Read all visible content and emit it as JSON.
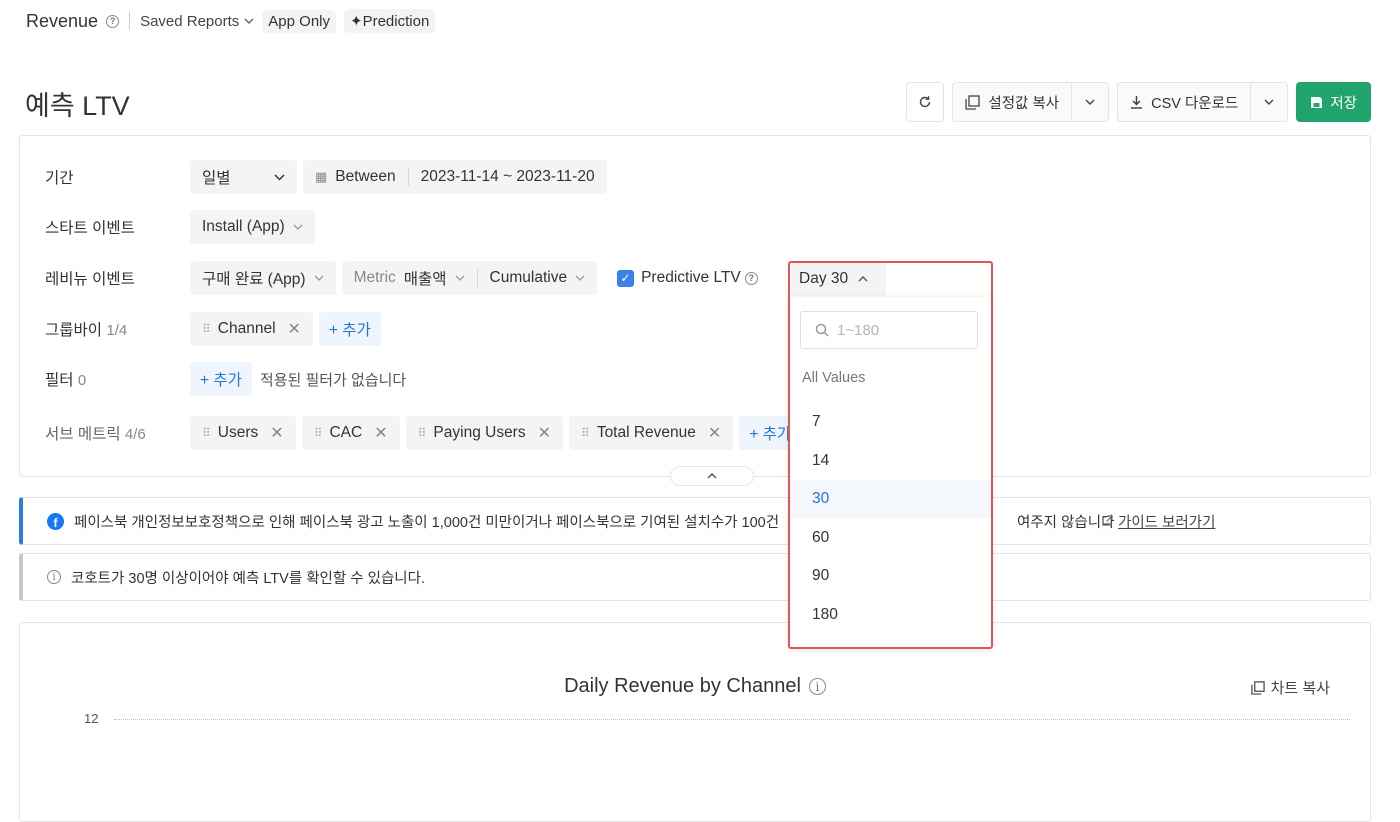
{
  "topbar": {
    "title": "Revenue",
    "saved_reports": "Saved Reports",
    "app_only": "App Only",
    "prediction": "Prediction"
  },
  "page": {
    "title": "예측 LTV"
  },
  "toolbar": {
    "copy_settings": "설정값 복사",
    "csv_download": "CSV 다운로드",
    "save": "저장"
  },
  "settings": {
    "period": {
      "label": "기간",
      "granularity": "일별",
      "operator": "Between",
      "date_range": "2023-11-14 ~ 2023-11-20"
    },
    "start_event": {
      "label": "스타트 이벤트",
      "value": "Install (App)"
    },
    "revenue_event": {
      "label": "레비뉴 이벤트",
      "event": "구매 완료 (App)",
      "metric_label": "Metric",
      "metric_value": "매출액",
      "mode": "Cumulative",
      "predictive_label": "Predictive LTV",
      "predictive_checked": true
    },
    "groupby": {
      "label": "그룹바이",
      "count": "1/4",
      "items": [
        "Channel"
      ],
      "add": "+ 추가"
    },
    "filter": {
      "label": "필터",
      "count": "0",
      "add": "+ 추가",
      "empty_text": "적용된 필터가 없습니다"
    },
    "sub_metrics": {
      "label": "서브 메트릭",
      "count": "4/6",
      "items": [
        "Users",
        "CAC",
        "Paying Users",
        "Total Revenue"
      ],
      "add": "+ 추가"
    }
  },
  "notices": {
    "facebook": "페이스북 개인정보보호정책으로 인해 페이스북 광고 노출이 1,000건 미만이거나 페이스북으로 기여된 설치수가 100건",
    "facebook_tail": "여주지 않습니다",
    "guide_link": "가이드 보러가기",
    "cohort": "코호트가 30명 이상이어야 예측 LTV를 확인할 수 있습니다."
  },
  "day_dropdown": {
    "selected": "Day 30",
    "search_placeholder": "1~180",
    "header": "All Values",
    "options": [
      "7",
      "14",
      "30",
      "60",
      "90",
      "180"
    ],
    "selected_option": "30"
  },
  "chart": {
    "title": "Daily Revenue by Channel",
    "copy_label": "차트 복사",
    "y_tick": "12"
  },
  "colors": {
    "primary_green": "#20a46b",
    "accent_blue": "#2673d9",
    "highlight_red": "#e25555"
  }
}
